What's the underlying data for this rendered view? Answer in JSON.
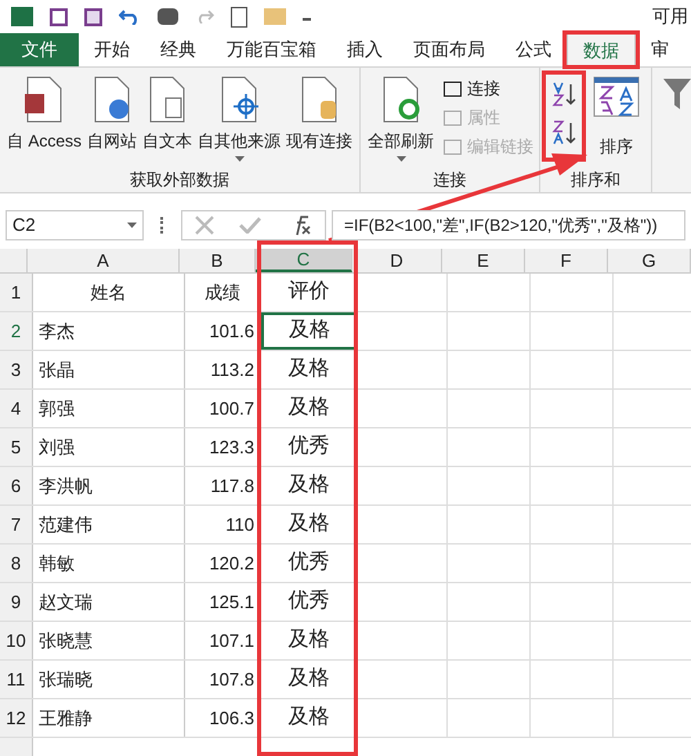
{
  "title_bar": {
    "text": "可用"
  },
  "tabs": [
    {
      "label": "文件",
      "kind": "file",
      "selected": false
    },
    {
      "label": "开始",
      "kind": "tab",
      "selected": false
    },
    {
      "label": "经典",
      "kind": "tab",
      "selected": false
    },
    {
      "label": "万能百宝箱",
      "kind": "tab",
      "selected": false
    },
    {
      "label": "插入",
      "kind": "tab",
      "selected": false
    },
    {
      "label": "页面布局",
      "kind": "tab",
      "selected": false
    },
    {
      "label": "公式",
      "kind": "tab",
      "selected": false
    },
    {
      "label": "数据",
      "kind": "tab",
      "selected": true
    },
    {
      "label": "审",
      "kind": "tab",
      "selected": false
    }
  ],
  "ribbon": {
    "groups": [
      {
        "label": "获取外部数据",
        "buttons": [
          {
            "label": "自 Access",
            "kind": "access"
          },
          {
            "label": "自网站",
            "kind": "web"
          },
          {
            "label": "自文本",
            "kind": "text"
          },
          {
            "label": "自其他来源",
            "kind": "other"
          },
          {
            "label": "现有连接",
            "kind": "existing"
          }
        ]
      },
      {
        "label": "连接",
        "buttons": [
          {
            "label": "全部刷新",
            "kind": "refresh"
          }
        ],
        "small": [
          {
            "label": "连接",
            "disabled": false
          },
          {
            "label": "属性",
            "disabled": true
          },
          {
            "label": "编辑链接",
            "disabled": true
          }
        ]
      },
      {
        "label": "排序和",
        "buttons": [
          {
            "label": "排序",
            "kind": "sort"
          }
        ]
      },
      {
        "buttons": [
          {
            "kind": "filter"
          }
        ]
      }
    ]
  },
  "formula_bar": {
    "name_box": "C2",
    "formula": "=IF(B2<100,\"差\",IF(B2>120,\"优秀\",\"及格\"))"
  },
  "columns": [
    "A",
    "B",
    "C",
    "D",
    "E",
    "F",
    "G"
  ],
  "rows": [
    {
      "num": "1",
      "name": "姓名",
      "score": "成绩",
      "grade": "评价"
    },
    {
      "num": "2",
      "name": "李杰",
      "score": "101.6",
      "grade": "及格",
      "selected": true
    },
    {
      "num": "3",
      "name": "张晶",
      "score": "113.2",
      "grade": "及格",
      "selected": false
    },
    {
      "num": "4",
      "name": "郭强",
      "score": "100.7",
      "grade": "及格",
      "selected": false
    },
    {
      "num": "5",
      "name": "刘强",
      "score": "123.3",
      "grade": "优秀",
      "selected": false
    },
    {
      "num": "6",
      "name": "李洪帆",
      "score": "117.8",
      "grade": "及格",
      "selected": false
    },
    {
      "num": "7",
      "name": "范建伟",
      "score": "110",
      "grade": "及格",
      "selected": false
    },
    {
      "num": "8",
      "name": "韩敏",
      "score": "120.2",
      "grade": "优秀",
      "selected": false
    },
    {
      "num": "9",
      "name": "赵文瑞",
      "score": "125.1",
      "grade": "优秀",
      "selected": false
    },
    {
      "num": "10",
      "name": "张晓慧",
      "score": "107.1",
      "grade": "及格",
      "selected": false
    },
    {
      "num": "11",
      "name": "张瑞晓",
      "score": "107.8",
      "grade": "及格",
      "selected": false
    },
    {
      "num": "12",
      "name": "王雅静",
      "score": "106.3",
      "grade": "及格",
      "selected": false
    }
  ]
}
